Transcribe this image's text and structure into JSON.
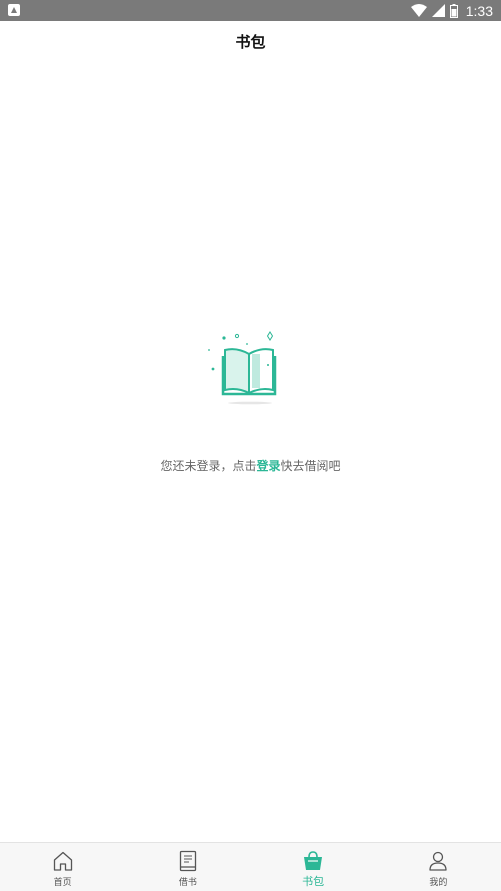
{
  "status_bar": {
    "time": "1:33",
    "app_icon": "notification-app-icon",
    "icons": [
      "wifi-icon",
      "signal-icon",
      "battery-icon"
    ]
  },
  "header": {
    "title": "书包"
  },
  "empty_state": {
    "illustration": "open-book-icon",
    "message_before": "您还未登录，点击",
    "login_link": "登录",
    "message_after": "快去借阅吧"
  },
  "tab_bar": {
    "active_index": 2,
    "tabs": [
      {
        "label": "首页",
        "icon": "home-icon"
      },
      {
        "label": "借书",
        "icon": "book-icon"
      },
      {
        "label": "书包",
        "icon": "bag-icon"
      },
      {
        "label": "我的",
        "icon": "user-icon"
      }
    ]
  },
  "colors": {
    "accent": "#2cb796",
    "status_bar": "#7a7a7a",
    "tab_bar_bg": "#f7f7f7",
    "text_muted": "#666666"
  }
}
